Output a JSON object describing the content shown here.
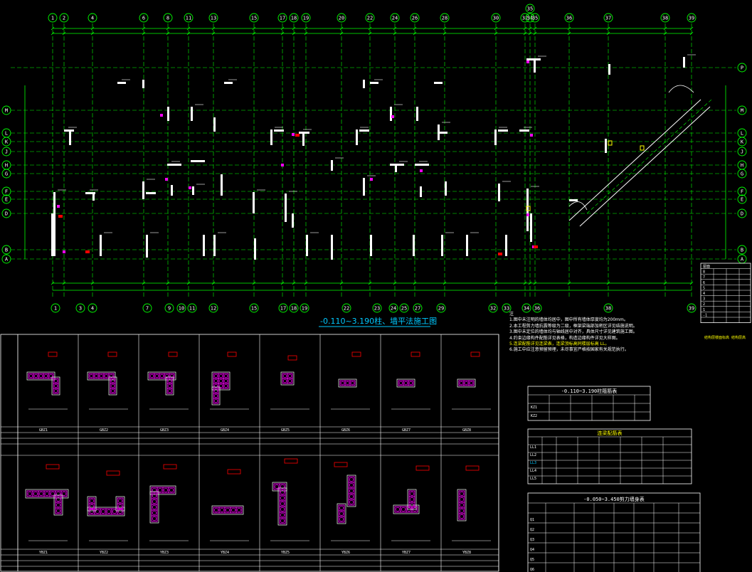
{
  "drawing": {
    "title": "-0.110~3.190柱、墙平法施工图",
    "colors": {
      "background": "#000000",
      "axis": "#00ff00",
      "dim": "#00ff00",
      "wall": "#ffffff",
      "column": "#ff00ff",
      "red": "#ff0000",
      "yellow": "#ffff00",
      "title": "#00c8ff"
    }
  },
  "axes": {
    "top_labels": [
      "1",
      "2",
      "4",
      "6",
      "8",
      "11",
      "13",
      "15",
      "17",
      "18",
      "19",
      "20",
      "22",
      "24",
      "26",
      "28",
      "30",
      "32",
      "34",
      "35",
      "36",
      "37",
      "38",
      "39"
    ],
    "bottom_labels": [
      "1",
      "3",
      "4",
      "7",
      "9",
      "10",
      "11",
      "12",
      "15",
      "17",
      "18",
      "19",
      "22",
      "23",
      "24",
      "25",
      "27",
      "29",
      "32",
      "33",
      "34",
      "36",
      "38",
      "39"
    ],
    "left_labels": [
      "M",
      "L",
      "K",
      "J",
      "H",
      "G",
      "F",
      "E",
      "D",
      "B",
      "A"
    ],
    "right_labels": [
      "P",
      "M",
      "L",
      "K",
      "J",
      "H",
      "G",
      "F",
      "E",
      "D",
      "B",
      "A"
    ]
  },
  "notes": {
    "heading": "注",
    "lines": [
      "1.图中未注明的墙体均居中，图中所有墙体厚度均为200mm。",
      "2.本工程剪力墙抗震等级为二级，框架梁端部加密区详见结施说明。",
      "3.图中未定位的墙体均与轴线居中对齐，具体尺寸详见建筑施工图。",
      "4.约束边缘构件配筋详见表格，构造边缘构件详见大样图。",
      "5.连梁配筋详见连梁表，连梁顶标高同楼层标高 LL。",
      "6.施工中应注意预留预埋，未尽事宜严格按国家有关规范执行。"
    ],
    "highlight": "约束边缘构件配筋详见表格，构造边缘构件详见大样图。"
  },
  "tables": {
    "column_table_title": "-0.110~3.190柱箍筋表",
    "lintel_table_title": "连梁配筋表",
    "wall_table_title": "-0.050~3.450剪力墙身表",
    "level_table_title": "结构层楼面标高 结构层高",
    "level_rows": [
      [
        "屋面",
        "",
        "",
        ""
      ],
      [
        "8",
        "",
        "",
        ""
      ],
      [
        "7",
        "",
        "",
        ""
      ],
      [
        "6",
        "",
        "",
        ""
      ],
      [
        "5",
        "",
        "",
        ""
      ],
      [
        "4",
        "",
        "",
        ""
      ],
      [
        "3",
        "",
        "",
        ""
      ],
      [
        "2",
        "",
        "",
        ""
      ],
      [
        "1",
        "",
        "",
        ""
      ],
      [
        "-1",
        "",
        "",
        ""
      ]
    ],
    "lintel_ids": [
      "LL1",
      "LL2",
      "LL3",
      "LL4",
      "LL5"
    ],
    "wall_ids": [
      "Q1",
      "Q2",
      "Q3",
      "Q4",
      "Q5",
      "Q6"
    ],
    "column_ids": [
      "KZ1",
      "KZ2"
    ]
  },
  "details": {
    "top_row_ids": [
      "GBZ1",
      "GBZ2",
      "GBZ3",
      "GBZ4",
      "GBZ5",
      "GBZ6",
      "GBZ7",
      "GBZ8"
    ],
    "bottom_row_ids": [
      "YBZ1",
      "YBZ2",
      "YBZ3",
      "YBZ4",
      "YBZ5",
      "YBZ6",
      "YBZ7",
      "YBZ8"
    ]
  }
}
